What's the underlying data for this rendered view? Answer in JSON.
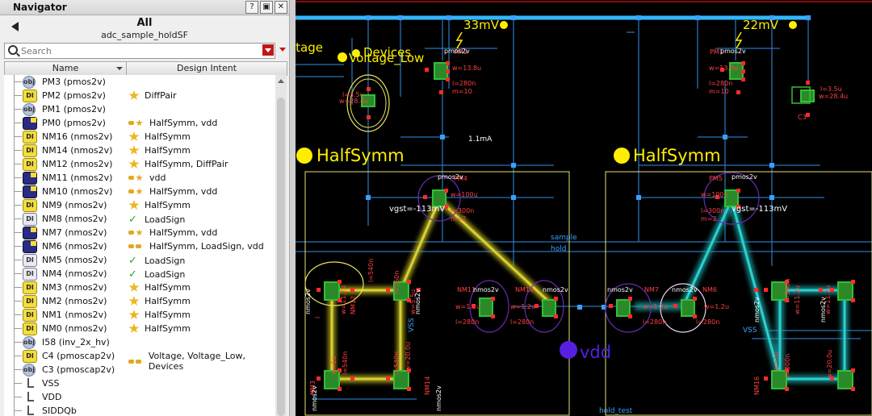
{
  "navigator": {
    "title": "Navigator",
    "title_buttons": [
      "?",
      "▣",
      "✕"
    ],
    "breadcrumb_title": "All",
    "breadcrumb_subtitle": "adc_sample_holdSF",
    "search_placeholder": "Search",
    "columns": [
      "Name",
      "Design Intent"
    ],
    "items": [
      {
        "name": "PM3 (pmos2v)",
        "icon": "obj",
        "intent": "",
        "mark": ""
      },
      {
        "name": "PM2 (pmos2v)",
        "icon": "di",
        "intent": "DiffPair",
        "mark": "star"
      },
      {
        "name": "PM1 (pmos2v)",
        "icon": "obj",
        "intent": "",
        "mark": ""
      },
      {
        "name": "PM0 (pmos2v)",
        "icon": "sq",
        "intent": "HalfSymm, vdd",
        "mark": "pair-star"
      },
      {
        "name": "NM16 (nmos2v)",
        "icon": "di",
        "intent": "HalfSymm",
        "mark": "star"
      },
      {
        "name": "NM14 (nmos2v)",
        "icon": "di",
        "intent": "HalfSymm",
        "mark": "star"
      },
      {
        "name": "NM12 (nmos2v)",
        "icon": "di",
        "intent": "HalfSymm, DiffPair",
        "mark": "star"
      },
      {
        "name": "NM11 (nmos2v)",
        "icon": "sq",
        "intent": "vdd",
        "mark": "pair-star"
      },
      {
        "name": "NM10 (nmos2v)",
        "icon": "sq",
        "intent": "HalfSymm, vdd",
        "mark": "pair-star"
      },
      {
        "name": "NM9 (nmos2v)",
        "icon": "di",
        "intent": "HalfSymm",
        "mark": "star"
      },
      {
        "name": "NM8 (nmos2v)",
        "icon": "diw",
        "intent": "LoadSign",
        "mark": "check"
      },
      {
        "name": "NM7 (nmos2v)",
        "icon": "sq",
        "intent": "HalfSymm, vdd",
        "mark": "pair-star"
      },
      {
        "name": "NM6 (nmos2v)",
        "icon": "sq",
        "intent": "HalfSymm, LoadSign, vdd",
        "mark": "pair-check"
      },
      {
        "name": "NM5 (nmos2v)",
        "icon": "diw",
        "intent": "LoadSign",
        "mark": "check"
      },
      {
        "name": "NM4 (nmos2v)",
        "icon": "diw",
        "intent": "LoadSign",
        "mark": "check"
      },
      {
        "name": "NM3 (nmos2v)",
        "icon": "di",
        "intent": "HalfSymm",
        "mark": "star"
      },
      {
        "name": "NM2 (nmos2v)",
        "icon": "di",
        "intent": "HalfSymm",
        "mark": "star"
      },
      {
        "name": "NM1 (nmos2v)",
        "icon": "di",
        "intent": "HalfSymm",
        "mark": "star"
      },
      {
        "name": "NM0 (nmos2v)",
        "icon": "di",
        "intent": "HalfSymm",
        "mark": "star"
      },
      {
        "name": "I58 (inv_2x_hv)",
        "icon": "obj",
        "intent": "",
        "mark": ""
      },
      {
        "name": "C4 (pmoscap2v)",
        "icon": "di",
        "intent": "Voltage, Voltage_Low, Devices",
        "mark": "pair"
      },
      {
        "name": "C3 (pmoscap2v)",
        "icon": "obj",
        "intent": "",
        "mark": ""
      },
      {
        "name": "VSS",
        "icon": "net",
        "intent": "",
        "mark": ""
      },
      {
        "name": "VDD",
        "icon": "net",
        "intent": "",
        "mark": ""
      },
      {
        "name": "SIDDQb",
        "icon": "net",
        "intent": "",
        "mark": ""
      }
    ]
  },
  "schematic": {
    "labels": {
      "v33": "33mV",
      "v22": "22mV",
      "voltage_partial": "ltage",
      "devices": "Devices",
      "voltage_low": "Voltage_Low",
      "halfsymm_left": "HalfSymm",
      "halfsymm_right": "HalfSymm",
      "vdd": "vdd",
      "current": "1.1mA",
      "sample": "sample",
      "hold": "hold",
      "vss_right": "VSS",
      "vss_left": "VSS",
      "hold_test": "hold_test",
      "vgst_left": "vgst=-113mV",
      "vgst_right": "vgst=-113mV",
      "pm3": "PM3",
      "pm1": "PM1",
      "pm4": "PM4",
      "pm5": "PM5",
      "pmos2v": "pmos2v",
      "nmos2v": "nmos2v",
      "nm11": "NM11",
      "nm10": "NM10",
      "nm7": "NM7",
      "nm6": "NM6",
      "nm12": "NM12",
      "nm3": "NM3",
      "nm14": "NM14",
      "nm16": "NM16",
      "c3": "C3",
      "w138": "w=13.8u",
      "l280": "l=280n",
      "m10": "m=10",
      "w100": "w=100u",
      "l300": "l=300n",
      "m2": "m=2",
      "w12": "w=1.2u",
      "l280n": "l=280n",
      "l35": "l=3.5u",
      "w284": "w=28.4u",
      "l540": "l=540n",
      "w112": "w=11.2u",
      "w55": "w=5.5u",
      "l560": "l=560n",
      "l800": "l=800n",
      "w1": "w=1u",
      "w20": "w=20.0u",
      "fragment_l": "l"
    },
    "colors": {
      "wire": "#3aa0ff",
      "bus": "#35b6ff",
      "box": "#e8e070",
      "red": "#ff2a2a",
      "green": "#33c033",
      "yellow_glow": "#c8c020",
      "cyan_glow": "#23b5b5",
      "dot_yellow": "#ffee00",
      "dot_purple": "#5520e0"
    }
  }
}
